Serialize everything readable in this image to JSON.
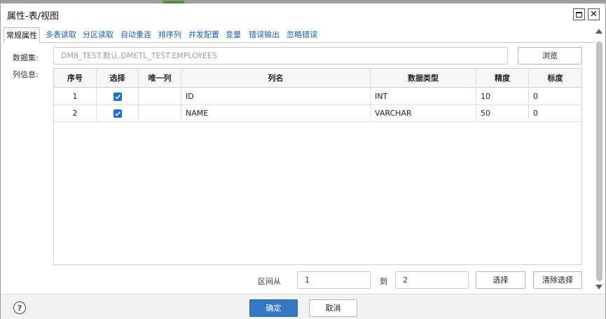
{
  "window": {
    "title": "属性-表/视图",
    "maximize_icon": "maximize-icon",
    "close_glyph": "✕"
  },
  "tabs": [
    {
      "label": "常规属性",
      "active": true
    },
    {
      "label": "多表读取"
    },
    {
      "label": "分区读取"
    },
    {
      "label": "自动重连"
    },
    {
      "label": "排序列"
    },
    {
      "label": "并发配置"
    },
    {
      "label": "变量"
    },
    {
      "label": "错误输出"
    },
    {
      "label": "忽略错误"
    }
  ],
  "form": {
    "dataset_label": "数据集:",
    "dataset_value": "DM8_TEST.默认.DMETL_TEST.EMPLOYEES",
    "browse_label": "浏览",
    "columns_label": "列信息:"
  },
  "table": {
    "headers": [
      "序号",
      "选择",
      "唯一列",
      "列名",
      "数据类型",
      "精度",
      "标度"
    ],
    "rows": [
      {
        "index": "1",
        "selected": true,
        "unique": "",
        "name": "ID",
        "type": "INT",
        "precision": "10",
        "scale": "0"
      },
      {
        "index": "2",
        "selected": true,
        "unique": "",
        "name": "NAME",
        "type": "VARCHAR",
        "precision": "50",
        "scale": "0"
      }
    ]
  },
  "range": {
    "from_label": "区间从",
    "from_value": "1",
    "to_label": "到",
    "to_value": "2",
    "select_label": "选择",
    "clear_label": "清除选择"
  },
  "footer": {
    "help_glyph": "?",
    "ok_label": "确定",
    "cancel_label": "取消"
  },
  "colors": {
    "primary_button": "#3578c4",
    "tab_link": "#1b5fa8",
    "checkbox": "#1a6fd1"
  }
}
